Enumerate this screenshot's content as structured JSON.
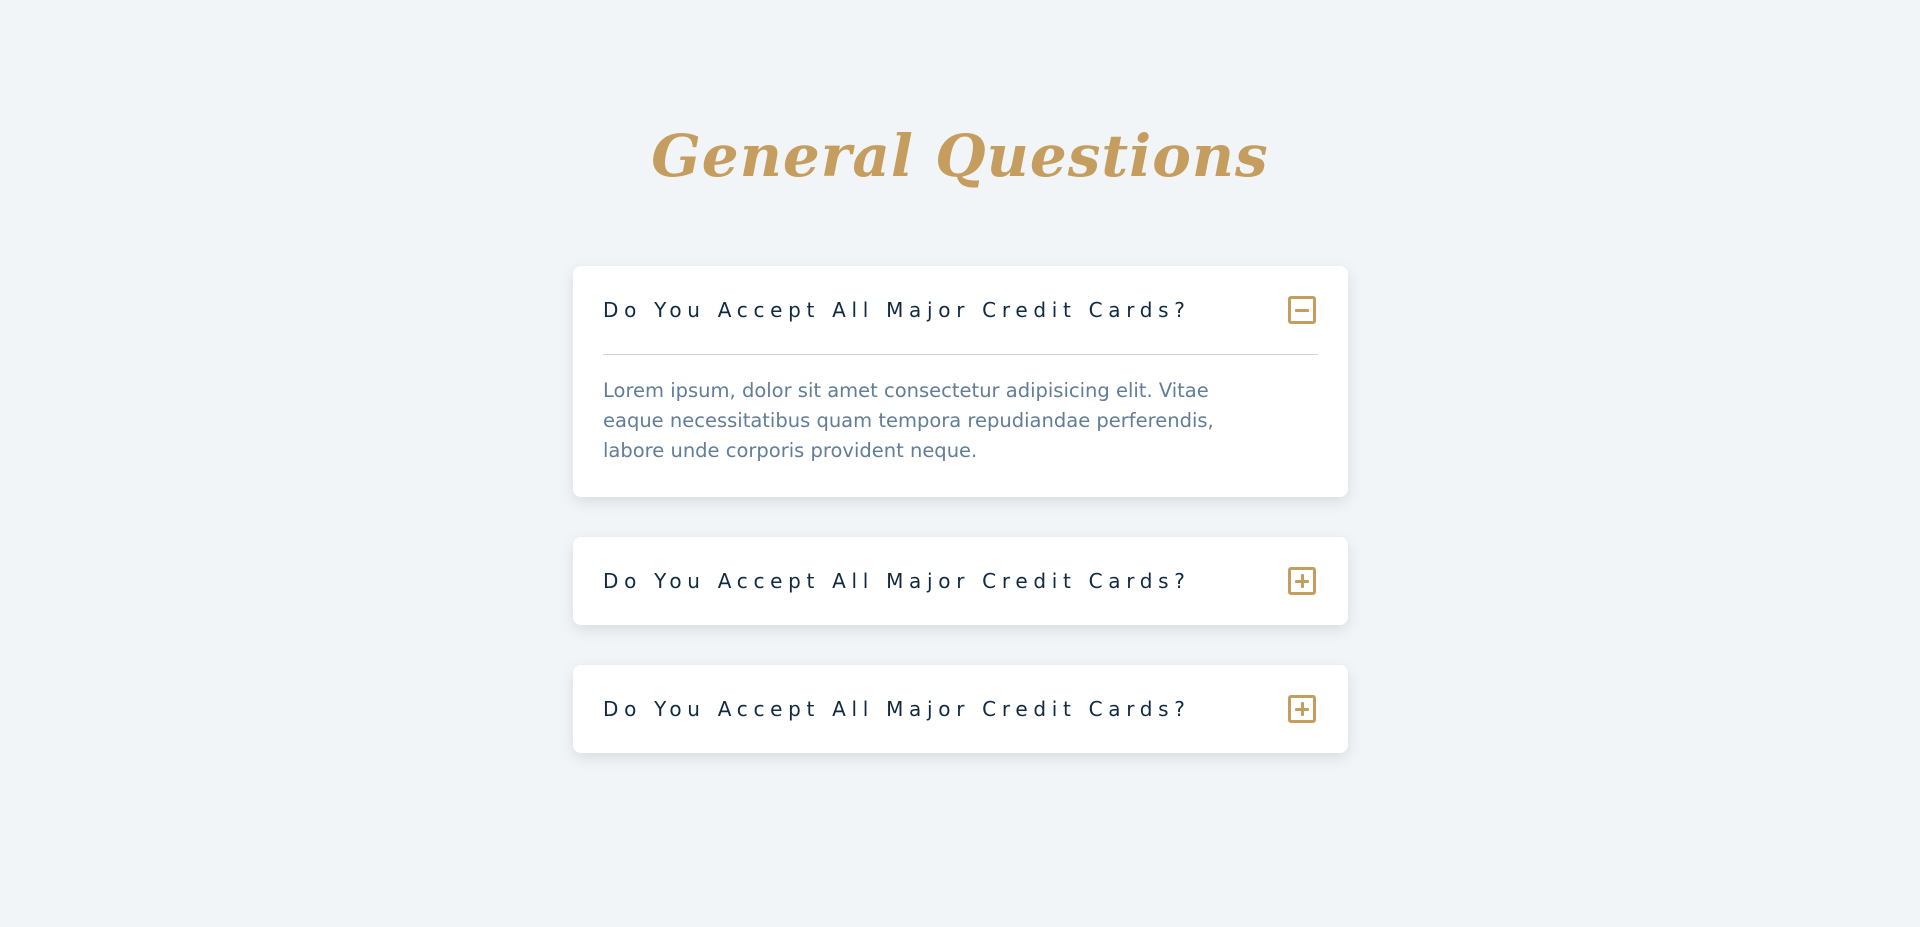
{
  "page": {
    "title": "General Questions"
  },
  "faqs": [
    {
      "question": "Do You Accept All Major Credit Cards?",
      "answer": "Lorem ipsum, dolor sit amet consectetur adipisicing elit. Vitae eaque necessitatibus quam tempora repudiandae perferendis, labore unde corporis provident neque.",
      "expanded": true,
      "toggle_icon": "minus-square-icon"
    },
    {
      "question": "Do You Accept All Major Credit Cards?",
      "expanded": false,
      "toggle_icon": "plus-square-icon"
    },
    {
      "question": "Do You Accept All Major Credit Cards?",
      "expanded": false,
      "toggle_icon": "plus-square-icon"
    }
  ],
  "colors": {
    "background": "#f1f5f8",
    "accent": "#c59d5f",
    "question_text": "#102a42",
    "answer_text": "#617d98",
    "card": "#ffffff"
  }
}
